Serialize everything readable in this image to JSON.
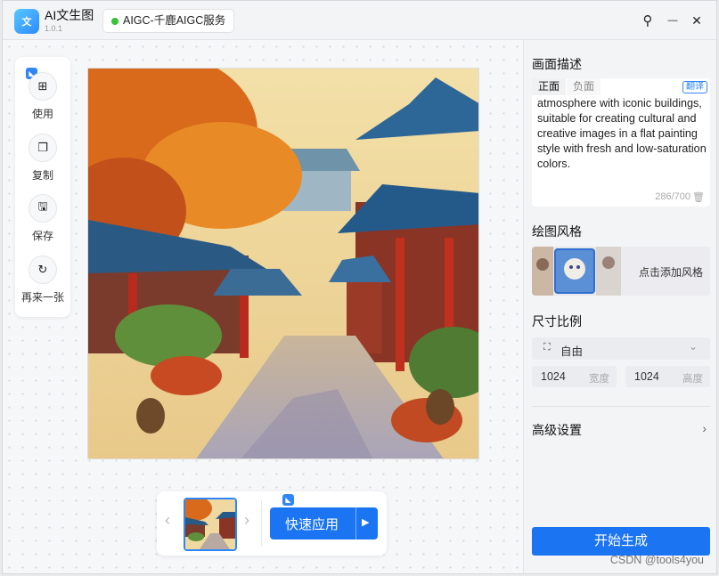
{
  "app": {
    "logo_text": "文",
    "name": "AI文生图",
    "version": "1.0.1",
    "service_label": "AIGC-千鹿AIGC服务",
    "service_status_color": "#37c23b"
  },
  "window_controls": {
    "pin_glyph": "⚲",
    "minimize_glyph": "—",
    "close_glyph": "✕"
  },
  "toolbar": {
    "items": [
      {
        "label": "使用",
        "icon": "use-icon",
        "glyph": "⊞"
      },
      {
        "label": "复制",
        "icon": "copy-icon",
        "glyph": "❐"
      },
      {
        "label": "保存",
        "icon": "save-icon",
        "glyph": "🖫"
      },
      {
        "label": "再来一张",
        "icon": "refresh-icon",
        "glyph": "↻"
      }
    ]
  },
  "thumbnail_bar": {
    "prev": "‹",
    "next": "›",
    "quick_apply_label": "快速应用",
    "quick_apply_arrow": "▶"
  },
  "prompt": {
    "section_title": "画面描述",
    "tab_positive": "正面",
    "tab_negative": "负面",
    "translate_label": "翻译",
    "text": "atmosphere with iconic buildings, suitable for creating cultural and creative images in a flat painting style with fresh and low-saturation colors.",
    "counter": "286/700",
    "trash_glyph": "🗑"
  },
  "style": {
    "section_title": "绘图风格",
    "add_label": "点击添加风格"
  },
  "size": {
    "section_title": "尺寸比例",
    "ratio_icon": "⛶",
    "ratio_value": "自由",
    "ratio_chevron": "⌄",
    "width_value": "1024",
    "width_unit": "宽度",
    "height_value": "1024",
    "height_unit": "高度"
  },
  "advanced": {
    "label": "高级设置",
    "chevron": "›"
  },
  "generate_label": "开始生成",
  "watermark": "CSDN @tools4you",
  "colors": {
    "accent": "#1b74f2"
  }
}
